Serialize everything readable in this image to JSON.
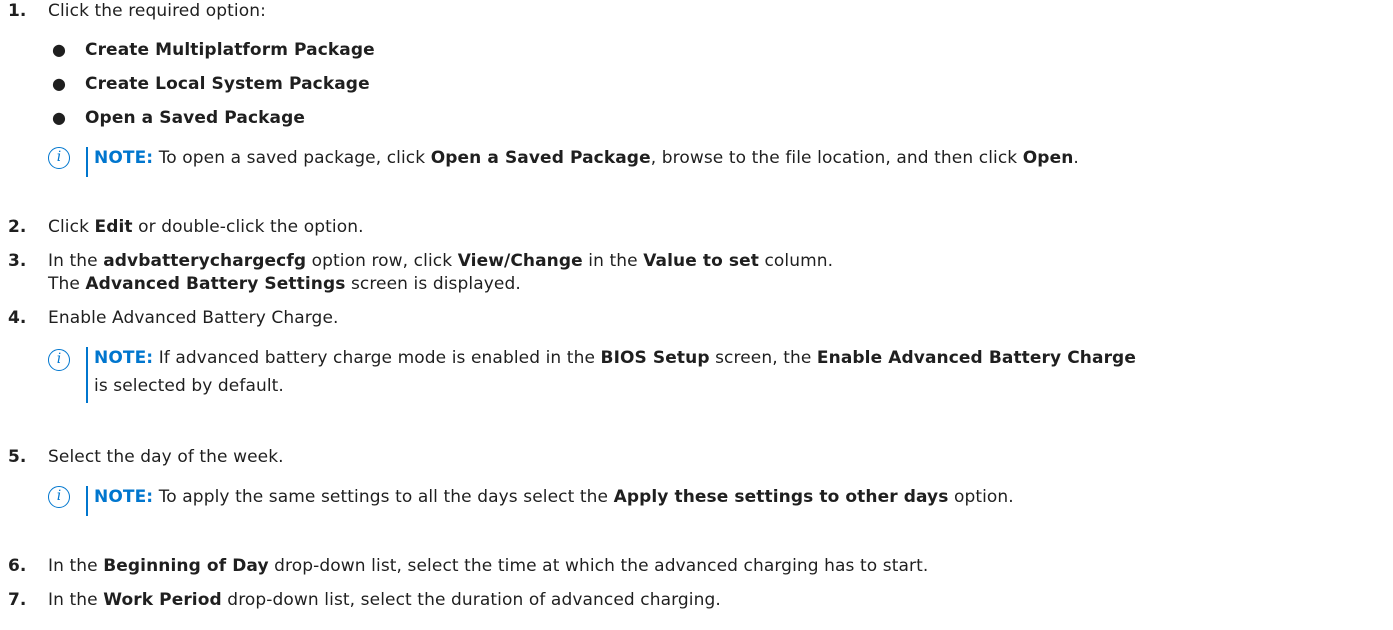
{
  "steps": [
    {
      "num": "1.",
      "text": "Click the required option:"
    },
    {
      "num": "2.",
      "pre": "Click ",
      "b1": "Edit",
      "post": " or double-click the option."
    },
    {
      "num": "3.",
      "pre": "In the ",
      "b1": "advbatterychargecfg",
      "mid1": " option row, click ",
      "b2": "View/Change",
      "mid2": " in the ",
      "b3": "Value to set",
      "post": " column.",
      "line2_pre": "The ",
      "line2_b": "Advanced Battery Settings",
      "line2_post": " screen is displayed."
    },
    {
      "num": "4.",
      "text": "Enable Advanced Battery Charge."
    },
    {
      "num": "5.",
      "text": "Select the day of the week."
    },
    {
      "num": "6.",
      "pre": "In the ",
      "b1": "Beginning of Day",
      "post": " drop-down list, select the time at which the advanced charging has to start."
    },
    {
      "num": "7.",
      "pre": "In the ",
      "b1": "Work Period",
      "post": " drop-down list, select the duration of advanced charging."
    }
  ],
  "options": [
    "Create Multiplatform Package",
    "Create Local System Package",
    "Open a Saved Package"
  ],
  "bullet_char": "●",
  "note_label": "NOTE:",
  "notes": [
    {
      "pre": " To open a saved package, click ",
      "b1": "Open a Saved Package",
      "mid": ", browse to the file location, and then click ",
      "b2": "Open",
      "post": "."
    },
    {
      "pre": " If advanced battery charge mode is enabled in the ",
      "b1": "BIOS Setup",
      "mid": " screen, the ",
      "b2": "Enable Advanced Battery Charge",
      "line2": "is selected by default."
    },
    {
      "pre": " To apply the same settings to all the days select the ",
      "b1": "Apply these settings to other days",
      "post": " option."
    }
  ],
  "icon_glyph": "i",
  "colors": {
    "accent": "#0076ce",
    "text": "#1f1f1f"
  }
}
